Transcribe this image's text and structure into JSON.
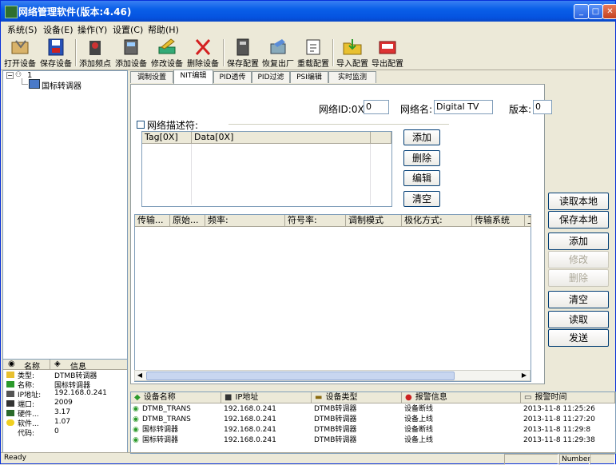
{
  "title": "网络管理软件(版本:4.46)",
  "menu": [
    "系统(S)",
    "设备(E)",
    "操作(Y)",
    "设置(C)",
    "帮助(H)"
  ],
  "toolbar": [
    "打开设备",
    "保存设备",
    "添加频点",
    "添加设备",
    "修改设备",
    "删除设备",
    "保存配置",
    "恢复出厂",
    "重载配置",
    "导入配置",
    "导出配置"
  ],
  "tree": {
    "root": "1",
    "child": "国标转调器"
  },
  "props": {
    "hdr_name": "名称",
    "hdr_info": "信息",
    "rows": [
      {
        "k": "类型:",
        "v": "DTMB转调器"
      },
      {
        "k": "名称:",
        "v": "国标转调器"
      },
      {
        "k": "IP地址:",
        "v": "192.168.0.241"
      },
      {
        "k": "端口:",
        "v": "2009"
      },
      {
        "k": "硬件...",
        "v": "3.17"
      },
      {
        "k": "软件...",
        "v": "1.07"
      },
      {
        "k": "代码:",
        "v": "0"
      }
    ]
  },
  "tabs": [
    "调制设置",
    "NIT编辑",
    "PID透传",
    "PID过滤",
    "PSI编辑",
    "实时监测"
  ],
  "nit": {
    "network_id_label": "网络ID:0X",
    "network_id_value": "0",
    "network_name_label": "网络名:",
    "network_name_value": "Digital TV",
    "version_label": "版本:",
    "version_value": "0",
    "descriptor_label": "网络描述符:",
    "desc_cols": [
      "Tag[0X]",
      "Data[0X]"
    ],
    "desc_buttons": [
      "添加",
      "删除",
      "编辑",
      "清空"
    ],
    "stream_cols": [
      "传输...",
      "原始...",
      "频率:",
      "符号率:",
      "调制模式",
      "极化方式:",
      "传输系统",
      "卫"
    ]
  },
  "side_buttons": [
    "读取本地",
    "保存本地",
    "添加",
    "修改",
    "删除",
    "清空",
    "读取",
    "发送"
  ],
  "log": {
    "cols": [
      "设备名称",
      "IP地址",
      "设备类型",
      "报警信息",
      "报警时间"
    ],
    "rows": [
      [
        "DTMB_TRANS",
        "192.168.0.241",
        "DTMB转调器",
        "设备断线",
        "2013-11-8 11:25:26"
      ],
      [
        "DTMB_TRANS",
        "192.168.0.241",
        "DTMB转调器",
        "设备上线",
        "2013-11-8 11:27:20"
      ],
      [
        "国标转调器",
        "192.168.0.241",
        "DTMB转调器",
        "设备断线",
        "2013-11-8 11:29:8"
      ],
      [
        "国标转调器",
        "192.168.0.241",
        "DTMB转调器",
        "设备上线",
        "2013-11-8 11:29:38"
      ]
    ]
  },
  "status": {
    "ready": "Ready",
    "number": "Number"
  },
  "colors": {
    "titlebar": "#0553e0",
    "window_bg": "#ece9d8",
    "accent_red": "#d42020"
  }
}
